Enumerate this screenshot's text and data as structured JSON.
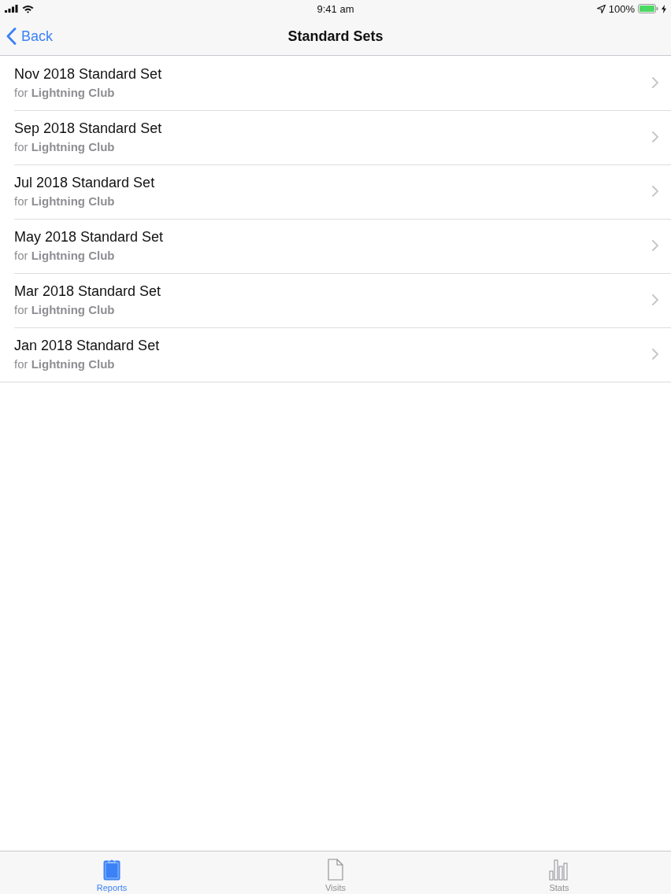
{
  "status_bar": {
    "time": "9:41 am",
    "battery_percent": "100%"
  },
  "nav_bar": {
    "back": "Back",
    "title": "Standard Sets"
  },
  "rows": [
    {
      "title": "Nov 2018 Standard Set",
      "subtitle": "for **Lightning Club**"
    },
    {
      "title": "Sep 2018 Standard Set",
      "subtitle": "for **Lightning Club**"
    },
    {
      "title": "Jul 2018 Standard Set",
      "subtitle": "for **Lightning Club**"
    },
    {
      "title": "May 2018 Standard Set",
      "subtitle": "for **Lightning Club**"
    },
    {
      "title": "Mar 2018 Standard Set",
      "subtitle": "for **Lightning Club**"
    },
    {
      "title": "Jan 2018 Standard Set",
      "subtitle": "for **Lightning Club**"
    }
  ],
  "tab_bar": [
    {
      "kind": "clipboard",
      "label": "Reports",
      "selected": true
    },
    {
      "kind": "document",
      "label": "Visits",
      "selected": false
    },
    {
      "kind": "chart",
      "label": "Stats",
      "selected": false
    }
  ]
}
